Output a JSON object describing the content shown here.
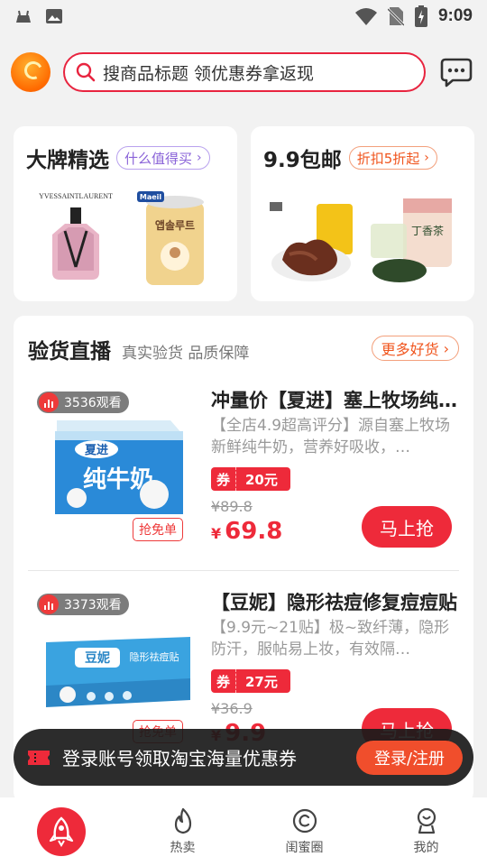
{
  "status_bar": {
    "time": "9:09"
  },
  "header": {
    "search_placeholder": "搜商品标题 领优惠券拿返现"
  },
  "promos": [
    {
      "title": "大牌精选",
      "tag": "什么值得买",
      "brand_text": "YVESSAINTLAURENT",
      "product_text": "앱솔루트",
      "product_brand": "Maeil"
    },
    {
      "title": "9.9包邮",
      "tag": "折扣5折起",
      "product_text": "丁香茶"
    }
  ],
  "live": {
    "title": "验货直播",
    "subtitle": "真实验货 品质保障",
    "more": "更多好货",
    "items": [
      {
        "viewers": "3536观看",
        "grab_tag": "抢免单",
        "title": "冲量价【夏进】塞上牧场纯牛奶",
        "desc": "【全店4.9超高评分】源自塞上牧场新鲜纯牛奶，营养好吸收，…",
        "coupon_label": "券",
        "coupon_value": "20元",
        "orig_price": "¥89.8",
        "currency": "¥",
        "price": "69.8",
        "buy": "马上抢",
        "box_brand": "夏进",
        "box_name": "纯牛奶"
      },
      {
        "viewers": "3373观看",
        "grab_tag": "抢免单",
        "title": "【豆妮】隐形祛痘修复痘痘贴",
        "desc": "【9.9元~21贴】极~致纤薄，隐形防汗，服帖易上妆，有效隔…",
        "coupon_label": "券",
        "coupon_value": "27元",
        "orig_price": "¥36.9",
        "currency": "¥",
        "price": "9.9",
        "buy": "马上抢",
        "box_brand": "豆妮",
        "box_name": "隐形祛痘贴"
      }
    ]
  },
  "login_banner": {
    "text": "登录账号领取淘宝海量优惠券",
    "button": "登录/注册"
  },
  "nav": [
    {
      "label": "",
      "icon": "rocket-icon"
    },
    {
      "label": "热卖",
      "icon": "flame-icon"
    },
    {
      "label": "闺蜜圈",
      "icon": "circle-chat-icon"
    },
    {
      "label": "我的",
      "icon": "profile-icon"
    }
  ],
  "colors": {
    "accent": "#ee2a3a",
    "orange": "#f0551e",
    "purple": "#8a63d8"
  }
}
